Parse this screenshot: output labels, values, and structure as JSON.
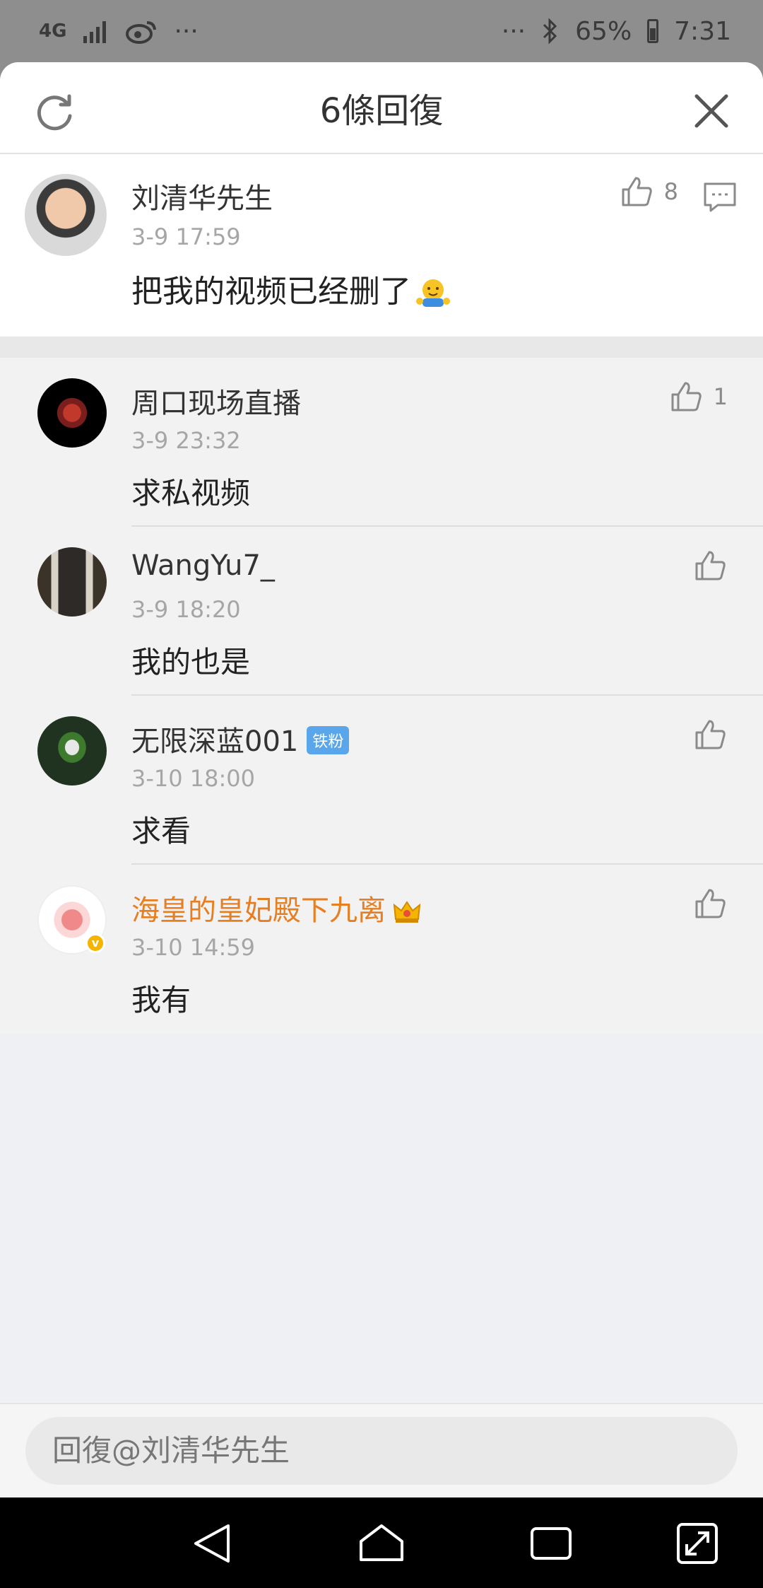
{
  "status_bar": {
    "network": "4G",
    "more": "···",
    "more_right": "···",
    "battery": "65%",
    "time": "7:31"
  },
  "header": {
    "title": "6條回復"
  },
  "main_comment": {
    "name": "刘清华先生",
    "time": "3-9 17:59",
    "content": "把我的视频已经删了",
    "likes": "8"
  },
  "replies": [
    {
      "name": "周口现场直播",
      "time": "3-9 23:32",
      "content": "求私视频",
      "likes": "1"
    },
    {
      "name": "WangYu7_",
      "time": "3-9 18:20",
      "content": "我的也是",
      "likes": ""
    },
    {
      "name": "无限深蓝001",
      "badge": "铁粉",
      "time": "3-10 18:00",
      "content": "求看",
      "likes": ""
    },
    {
      "name": "海皇的皇妃殿下九离",
      "time": "3-10 14:59",
      "content": "我有",
      "likes": "",
      "name_color": "#e67e22"
    }
  ],
  "input": {
    "placeholder": "回復@刘清华先生"
  }
}
